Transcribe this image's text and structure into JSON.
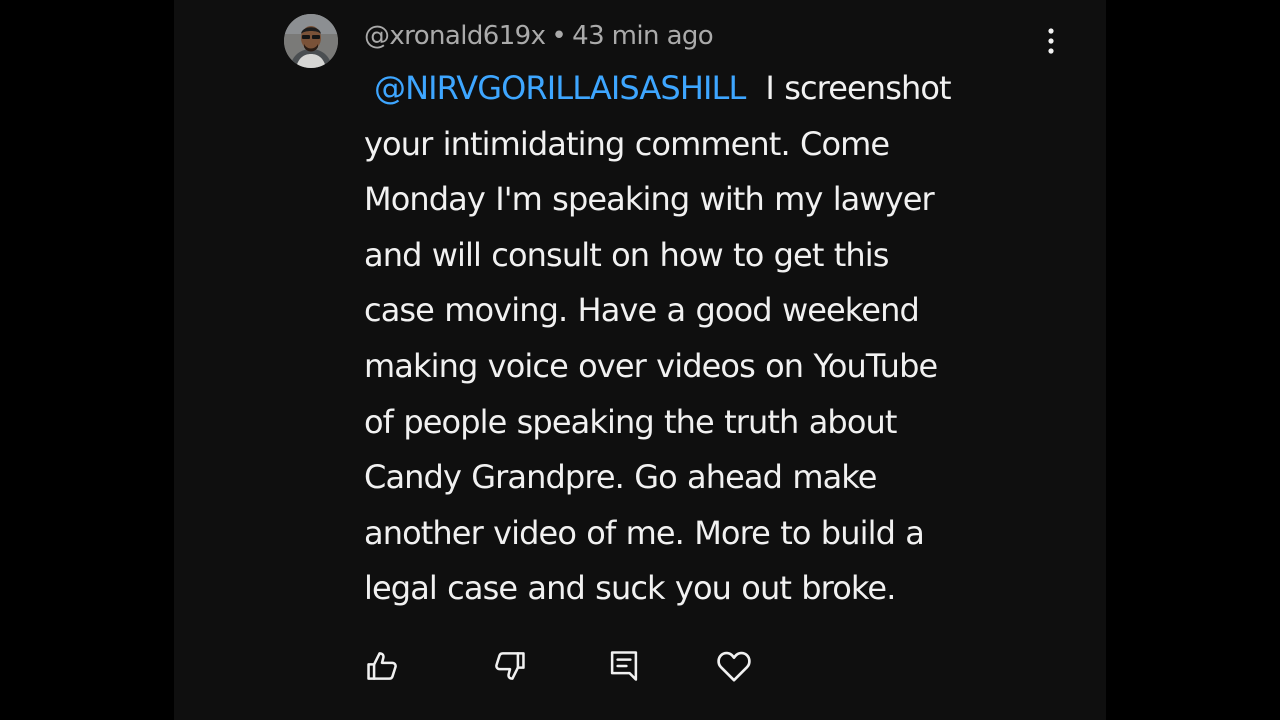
{
  "comment": {
    "author": "@xronald619x",
    "separator": "•",
    "time": "43 min ago",
    "mention": "@NIRVGORILLAISASHILL",
    "lines": [
      "I screenshot",
      "your intimidating comment. Come",
      "Monday I'm speaking with my lawyer",
      "and will consult on how to get this",
      "case moving. Have a good weekend",
      "making voice over videos on YouTube",
      "of people speaking the truth about",
      "Candy Grandpre.  Go ahead make",
      "another video of me. More to build a",
      "legal case and suck you out broke."
    ]
  },
  "actions": {
    "icons": [
      "thumbs-up-icon",
      "thumbs-down-icon",
      "reply-icon",
      "heart-icon"
    ]
  },
  "colors": {
    "background": "#0f0f0f",
    "text": "#f1f1f1",
    "meta": "#aaaaaa",
    "mention": "#3ea6ff"
  }
}
